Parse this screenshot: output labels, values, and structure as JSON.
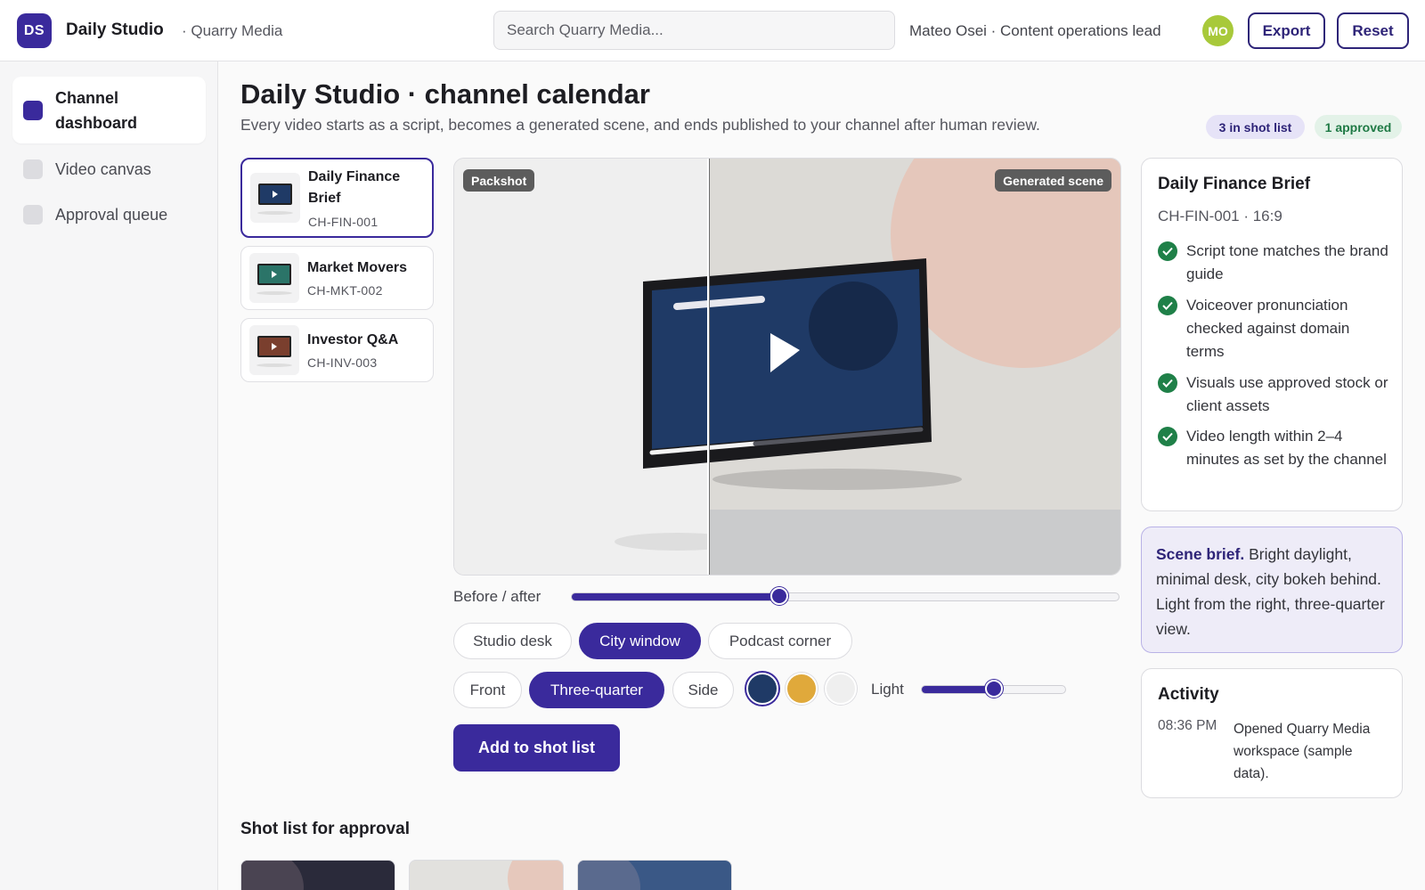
{
  "app": {
    "logo_initials": "DS",
    "name": "Daily Studio",
    "workspace": "· Quarry Media",
    "brand_color": "#3a2a9c"
  },
  "header": {
    "search_placeholder": "Search Quarry Media...",
    "user": "Mateo Osei · Content operations lead",
    "avatar_initials": "MO",
    "export_label": "Export",
    "reset_label": "Reset"
  },
  "sidebar": {
    "items": [
      {
        "label": "Channel dashboard",
        "active": true
      },
      {
        "label": "Video canvas",
        "active": false
      },
      {
        "label": "Approval queue",
        "active": false
      }
    ]
  },
  "main": {
    "title": "Daily Studio · channel calendar",
    "subtitle": "Every video starts as a script, becomes a generated scene, and ends published to your channel after human review.",
    "pill_shot_list": "3 in shot list",
    "pill_approved": "1 approved"
  },
  "videos": [
    {
      "title": "Daily Finance Brief",
      "code": "CH-FIN-001",
      "screen_color": "#1f3a66",
      "selected": true
    },
    {
      "title": "Market Movers",
      "code": "CH-MKT-002",
      "screen_color": "#2b7468",
      "selected": false
    },
    {
      "title": "Investor Q&A",
      "code": "CH-INV-003",
      "screen_color": "#7a3f2e",
      "selected": false
    }
  ],
  "stage": {
    "tag_left": "Packshot",
    "tag_right": "Generated scene",
    "before_after_label": "Before / after",
    "before_after_value": 0.38
  },
  "scenes": {
    "options": [
      "Studio desk",
      "City window",
      "Podcast corner"
    ],
    "selected": "City window"
  },
  "angles": {
    "options": [
      "Front",
      "Three-quarter",
      "Side"
    ],
    "selected": "Three-quarter"
  },
  "swatches": [
    {
      "name": "navy",
      "color": "#1f3a66",
      "selected": true
    },
    {
      "name": "mustard",
      "color": "#e0a93b",
      "selected": false
    },
    {
      "name": "light-grey",
      "color": "#efefef",
      "selected": false
    }
  ],
  "light": {
    "label": "Light",
    "value": 0.5
  },
  "add_button_label": "Add to shot list",
  "shot_list_title": "Shot list for approval",
  "info": {
    "title": "Daily Finance Brief",
    "meta": "CH-FIN-001 · 16:9",
    "checks": [
      "Script tone matches the brand guide",
      "Voiceover pronunciation checked against domain terms",
      "Visuals use approved stock or client assets",
      "Video length within 2–4 minutes as set by the channel"
    ]
  },
  "brief": {
    "label": "Scene brief.",
    "text": "Bright daylight, minimal desk, city bokeh behind. Light from the right, three-quarter view."
  },
  "activity": {
    "title": "Activity",
    "time": "08:36 PM",
    "text": "Opened Quarry Media workspace (sample data)."
  }
}
